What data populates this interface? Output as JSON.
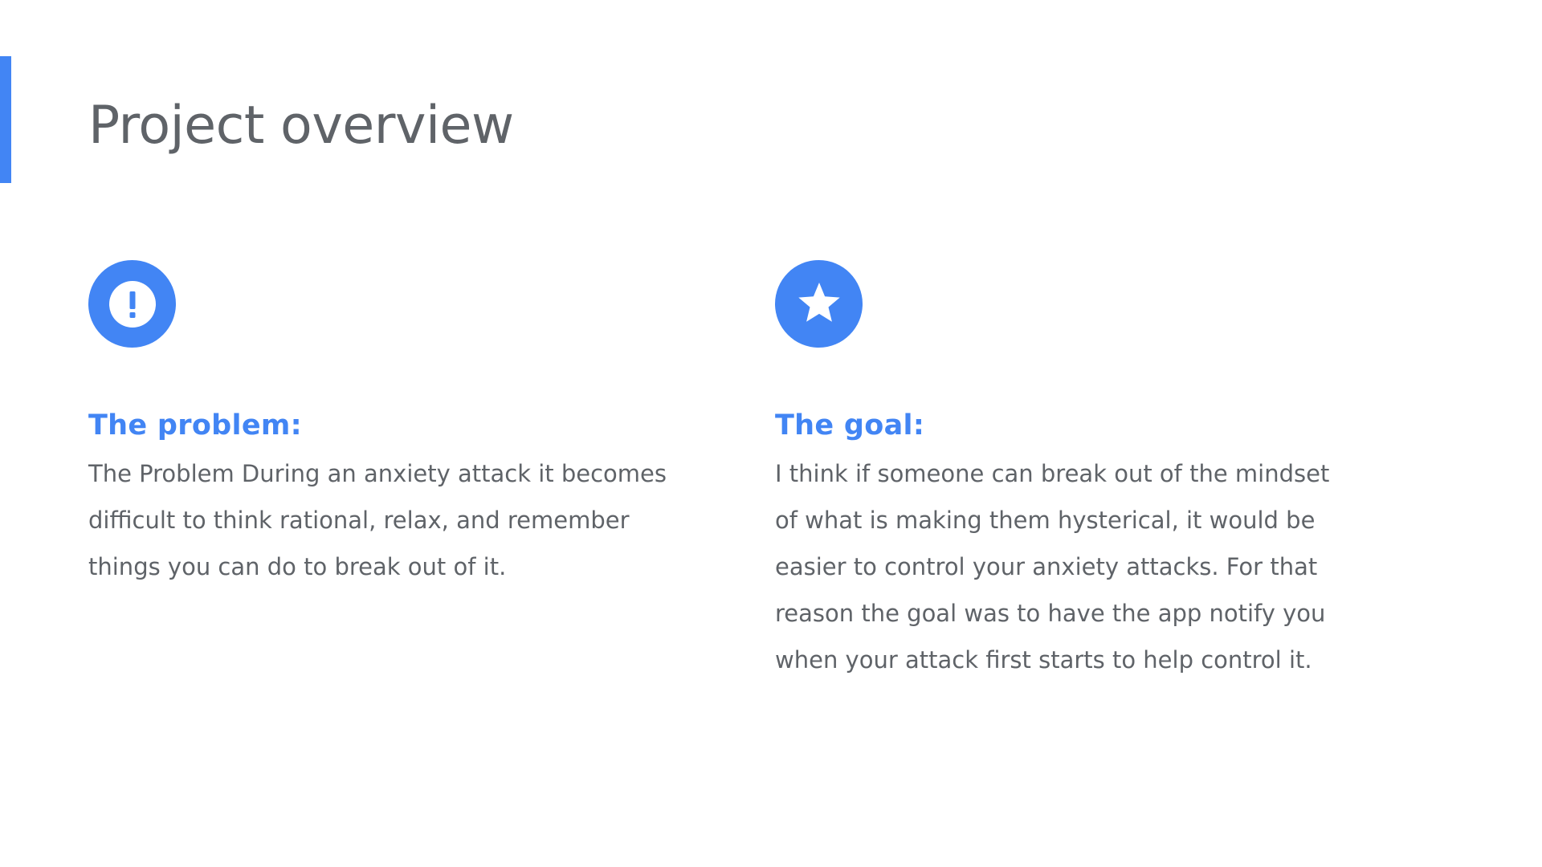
{
  "colors": {
    "accent": "#4285f4",
    "title_text": "#5f6368",
    "body_text": "#5f6368",
    "background": "#ffffff"
  },
  "slide": {
    "title": "Project overview"
  },
  "problem": {
    "icon": "exclamation-icon",
    "heading": "The problem:",
    "body": "The Problem During an anxiety attack it becomes difficult to think rational, relax, and remember things you can do to break out of it."
  },
  "goal": {
    "icon": "star-icon",
    "heading": "The goal:",
    "body": "I think if someone can break out of the mindset of what is making them hysterical, it would be easier to control your anxiety attacks. For that reason the goal was to have the app notify you when your attack first starts to help control it."
  }
}
